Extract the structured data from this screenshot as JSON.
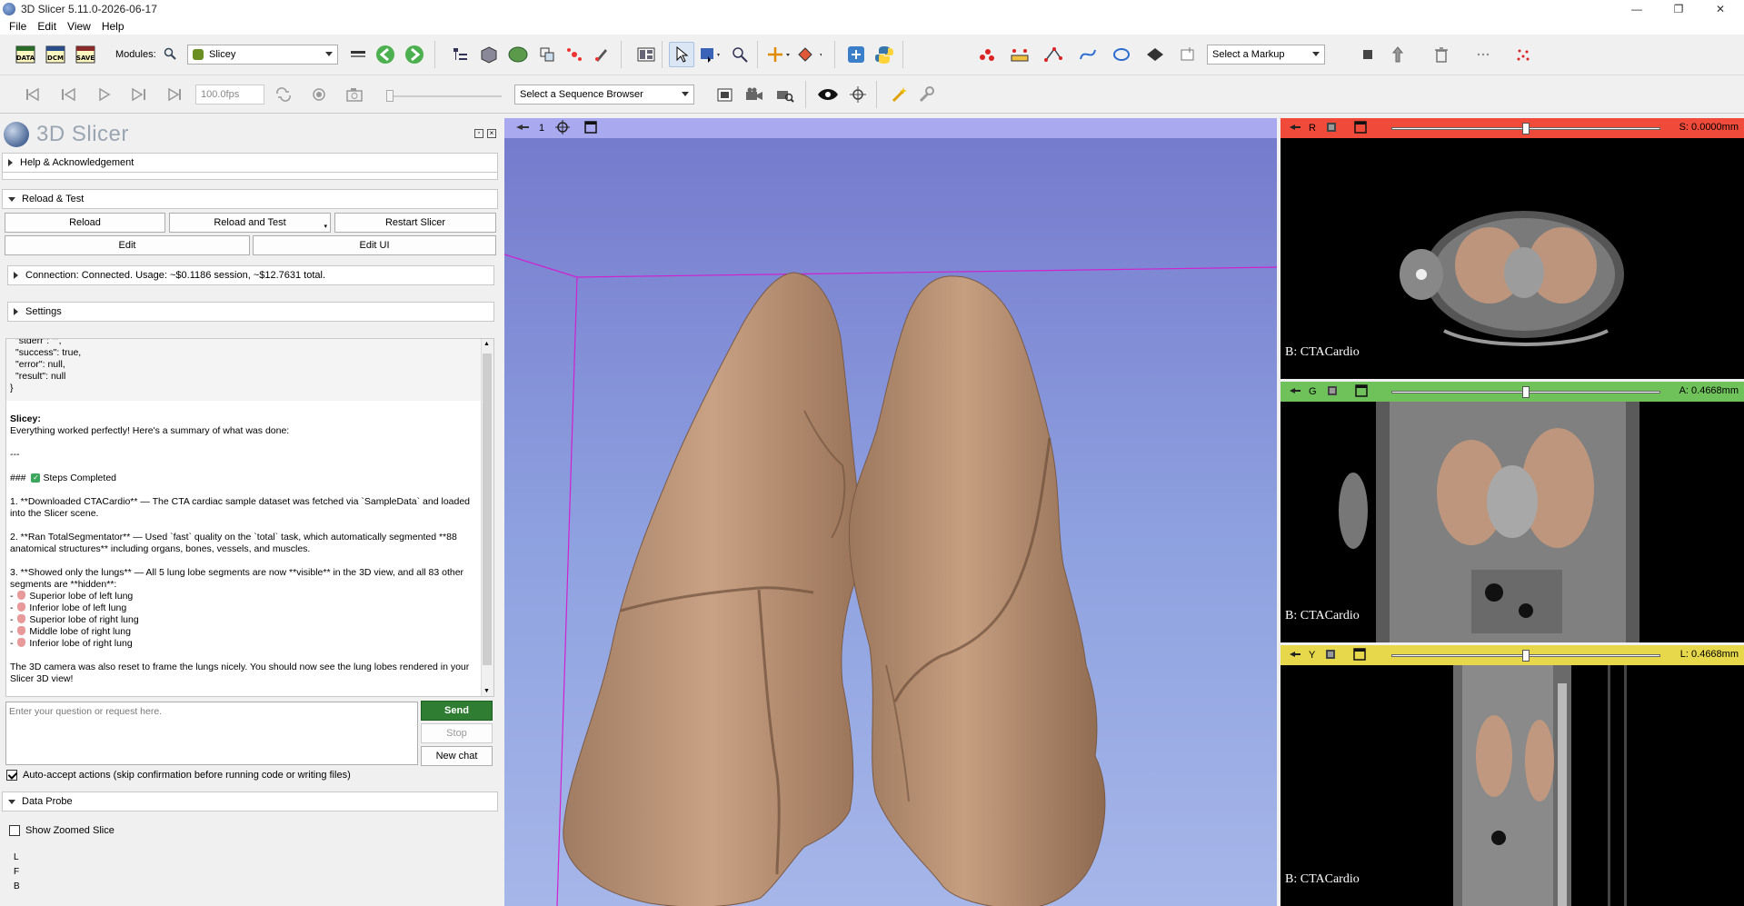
{
  "window": {
    "title": "3D Slicer 5.11.0-2026-06-17",
    "minimize": "—",
    "maximize": "❐",
    "close": "✕"
  },
  "menu": [
    "File",
    "Edit",
    "View",
    "Help"
  ],
  "toolbar": {
    "data_label": "DATA",
    "dcm_label": "DCM",
    "save_label": "SAVE",
    "modules_label": "Modules:",
    "module_selected": "Slicey",
    "markup_selected": "Select a Markup",
    "fps_value": "100.0fps",
    "sequence_browser": "Select a Sequence Browser"
  },
  "panel": {
    "logo_text": "3D Slicer",
    "help_section": "Help & Acknowledgement",
    "reload_section": "Reload & Test",
    "reload": "Reload",
    "reload_and_test": "Reload and Test",
    "restart": "Restart Slicer",
    "edit": "Edit",
    "edit_ui": "Edit UI",
    "connection": "Connection: Connected. Usage: ~$0.1186 session, ~$12.7631 total.",
    "settings": "Settings",
    "data_probe": "Data Probe",
    "show_zoomed": "Show Zoomed Slice",
    "probe_l": "L",
    "probe_f": "F",
    "probe_b": "B"
  },
  "chat": {
    "code_lines": [
      "\"stderr\": \"\",",
      "\"success\": true,",
      "\"error\": null,",
      "\"result\": null",
      "}"
    ],
    "sender": "Slicey:",
    "intro": "Everything worked perfectly! Here's a summary of what was done:",
    "hr": "---",
    "steps_heading_prefix": "###",
    "steps_heading": "Steps Completed",
    "step1": "1. **Downloaded CTACardio** — The CTA cardiac sample dataset was fetched via `SampleData` and loaded into the Slicer scene.",
    "step2": "2. **Ran TotalSegmentator** — Used `fast` quality on the `total` task, which automatically segmented **88 anatomical structures** including organs, bones, vessels, and muscles.",
    "step3": "3. **Showed only the lungs** — All 5 lung lobe segments are now **visible** in the 3D view, and all 83 other segments are **hidden**:",
    "lobes": [
      "Superior lobe of left lung",
      "Inferior lobe of left lung",
      "Superior lobe of right lung",
      "Middle lobe of right lung",
      "Inferior lobe of right lung"
    ],
    "outro": "The 3D camera was also reset to frame the lungs nicely. You should now see the lung lobes rendered in your Slicer 3D view!",
    "input_placeholder": "Enter your question or request here.",
    "send": "Send",
    "stop": "Stop",
    "new_chat": "New chat",
    "auto_accept": "Auto-accept actions (skip confirmation before running code or writing files)"
  },
  "view3d": {
    "view_number": "1"
  },
  "slices": {
    "red": {
      "letter": "R",
      "value": "S: 0.0000mm",
      "label": "B: CTACardio",
      "color": "#f04a3a",
      "slider": 0.5
    },
    "green": {
      "letter": "G",
      "value": "A: 0.4668mm",
      "label": "B: CTACardio",
      "color": "#6fc25a",
      "slider": 0.5
    },
    "yellow": {
      "letter": "Y",
      "value": "L: 0.4668mm",
      "label": "B: CTACardio",
      "color": "#e6d84a",
      "slider": 0.5
    }
  },
  "colors": {
    "lung": "#c9a184",
    "send_button": "#2e7d32"
  }
}
